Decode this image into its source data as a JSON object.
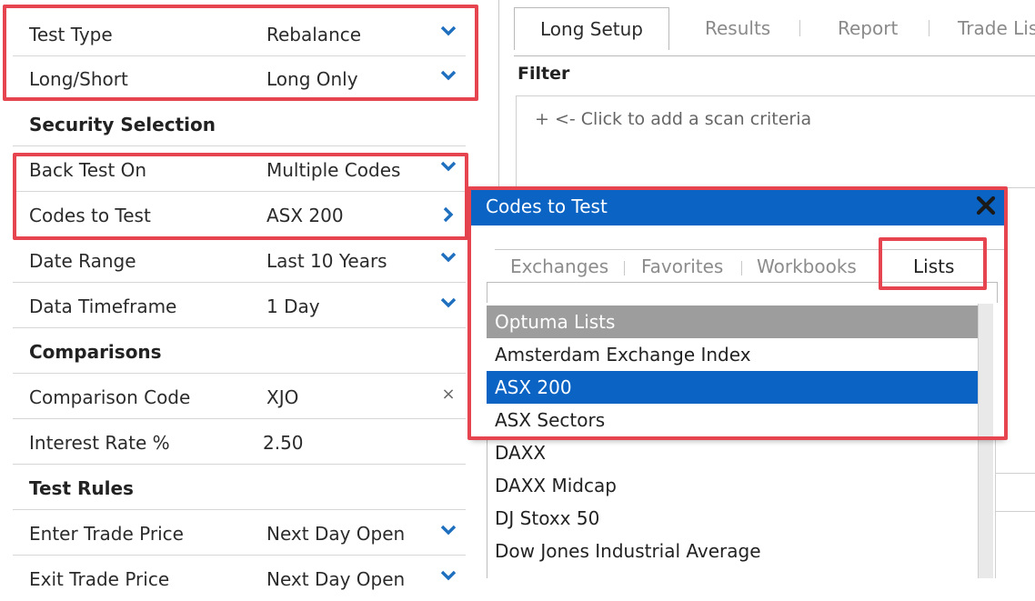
{
  "left_panel": {
    "rows": [
      {
        "label": "Test Type",
        "value": "Rebalance",
        "control": "chevron-down"
      },
      {
        "label": "Long/Short",
        "value": "Long Only",
        "control": "chevron-down"
      },
      {
        "label": "Security Selection",
        "value": "",
        "control": "none"
      },
      {
        "label": "Back Test On",
        "value": "Multiple Codes",
        "control": "chevron-down"
      },
      {
        "label": "Codes to Test",
        "value": "ASX 200",
        "control": "chevron-right"
      },
      {
        "label": "Date Range",
        "value": "Last 10 Years",
        "control": "chevron-down"
      },
      {
        "label": "Data Timeframe",
        "value": "1 Day",
        "control": "chevron-down"
      },
      {
        "label": "Comparisons",
        "value": "",
        "control": "none"
      },
      {
        "label": "Comparison Code",
        "value": "XJO",
        "control": "clear-x"
      },
      {
        "label": "Interest Rate %",
        "value": "2.50",
        "control": "none"
      },
      {
        "label": "Test Rules",
        "value": "",
        "control": "none"
      },
      {
        "label": "Enter Trade Price",
        "value": "Next Day Open",
        "control": "chevron-down"
      },
      {
        "label": "Exit Trade Price",
        "value": "Next Day Open",
        "control": "chevron-down"
      }
    ],
    "clear_glyph": "×"
  },
  "tabs": [
    {
      "label": "Long Setup",
      "active": true
    },
    {
      "label": "Results",
      "active": false
    },
    {
      "label": "Report",
      "active": false
    },
    {
      "label": "Trade Lis",
      "active": false
    }
  ],
  "filter": {
    "title": "Filter",
    "add_text": "+ <- Click to add a scan criteria"
  },
  "popup": {
    "title": "Codes to Test",
    "tabs": [
      {
        "label": "Exchanges",
        "active": false
      },
      {
        "label": "Favorites",
        "active": false
      },
      {
        "label": "Workbooks",
        "active": false
      },
      {
        "label": "Lists",
        "active": true
      }
    ],
    "items": [
      {
        "label": "Optuma Lists",
        "kind": "group"
      },
      {
        "label": "Amsterdam Exchange Index",
        "kind": "item"
      },
      {
        "label": "ASX 200",
        "kind": "selected"
      },
      {
        "label": "ASX Sectors",
        "kind": "item"
      }
    ]
  },
  "list_below": {
    "items": [
      "DAXX",
      "DAXX Midcap",
      "DJ Stoxx 50",
      "Dow Jones Industrial Average"
    ]
  },
  "colors": {
    "accent": "#0b63c4",
    "highlight": "#e6444f",
    "group_header": "#9d9d9d"
  }
}
